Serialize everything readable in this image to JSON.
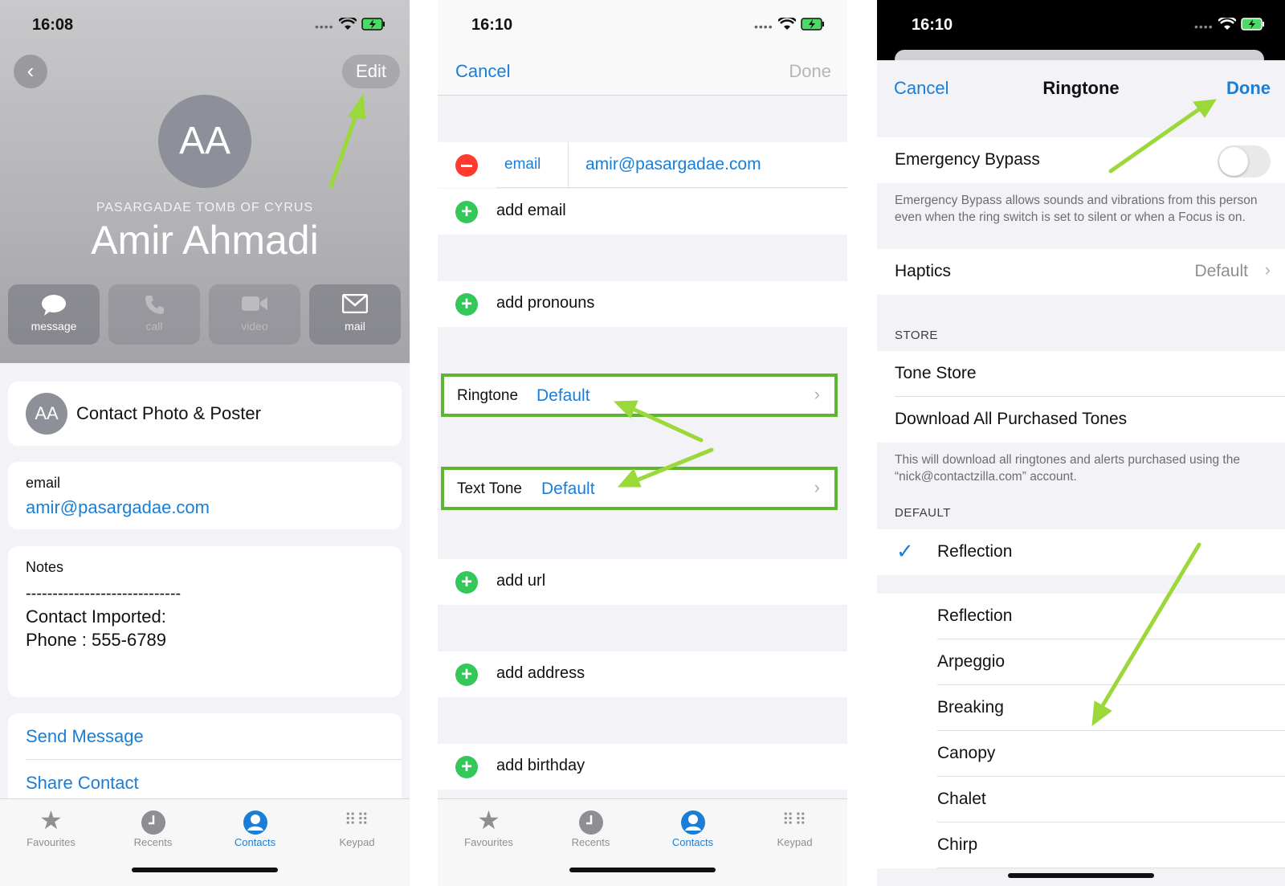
{
  "panel1": {
    "time": "16:08",
    "edit_label": "Edit",
    "avatar_initials": "AA",
    "company": "PASARGADAE TOMB OF CYRUS",
    "name": "Amir Ahmadi",
    "actions": [
      {
        "label": "message",
        "icon": "message-bubble-icon"
      },
      {
        "label": "call",
        "icon": "phone-icon"
      },
      {
        "label": "video",
        "icon": "video-camera-icon"
      },
      {
        "label": "mail",
        "icon": "envelope-icon"
      }
    ],
    "photo_poster_label": "Contact Photo & Poster",
    "email_label": "email",
    "email_value": "amir@pasargadae.com",
    "notes_label": "Notes",
    "notes_line1": "-----------------------------",
    "notes_line2": "Contact Imported:",
    "notes_line3": "Phone : 555-6789",
    "send_message": "Send Message",
    "share_contact": "Share Contact"
  },
  "panel2": {
    "time": "16:10",
    "cancel": "Cancel",
    "done": "Done",
    "email_type": "email",
    "email_value": "amir@pasargadae.com",
    "add_email": "add email",
    "add_pronouns": "add pronouns",
    "ringtone_label": "Ringtone",
    "ringtone_value": "Default",
    "texttone_label": "Text Tone",
    "texttone_value": "Default",
    "add_url": "add url",
    "add_address": "add address",
    "add_birthday": "add birthday"
  },
  "panel3": {
    "time": "16:10",
    "cancel": "Cancel",
    "title": "Ringtone",
    "done": "Done",
    "emergency_bypass": "Emergency Bypass",
    "emergency_bypass_on": false,
    "emergency_note": "Emergency Bypass allows sounds and vibrations from this person even when the ring switch is set to silent or when a Focus is on.",
    "haptics": "Haptics",
    "haptics_value": "Default",
    "store_header": "STORE",
    "tone_store": "Tone Store",
    "download_all": "Download All Purchased Tones",
    "download_note": "This will download all ringtones and alerts purchased using the “nick@contactzilla.com” account.",
    "default_header": "DEFAULT",
    "selected_tone": "Reflection",
    "tones": [
      "Reflection",
      "Arpeggio",
      "Breaking",
      "Canopy",
      "Chalet",
      "Chirp"
    ]
  },
  "tabbar": {
    "tabs": [
      {
        "label": "Favourites",
        "icon": "star-icon"
      },
      {
        "label": "Recents",
        "icon": "clock-icon"
      },
      {
        "label": "Contacts",
        "icon": "person-circle-icon"
      },
      {
        "label": "Keypad",
        "icon": "keypad-icon"
      }
    ],
    "active": "Contacts"
  },
  "colors": {
    "accent": "#1a7ed6",
    "highlight_box": "#5eb52f",
    "arrow": "#9bd93a",
    "add_green": "#34c759",
    "delete_red": "#ff3b30"
  }
}
